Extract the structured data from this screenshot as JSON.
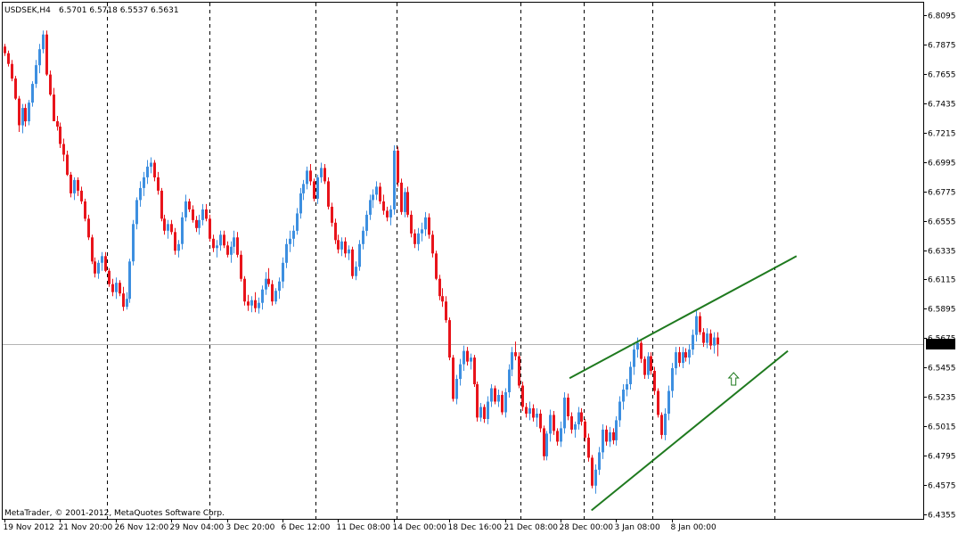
{
  "header": {
    "symbol": "USDSEK,H4",
    "ohlc": "6.5701 6.5718 6.5537 6.5631"
  },
  "footer": {
    "copyright": "MetaTrader, © 2001-2012, MetaQuotes Software Corp."
  },
  "colors": {
    "up": "#3d8fe0",
    "down": "#e8141b",
    "trendline": "#1f7a1f",
    "arrow": "#1f7a1f",
    "grid": "#000000",
    "priceline": "#b4b4b4",
    "axis": "#000000",
    "label_bg": "#000000",
    "label_fg": "#ffffff"
  },
  "chart_data": {
    "type": "candlestick",
    "timeframe": "H4",
    "current_price_label": "6.5631",
    "current_price": 6.5631,
    "ylim": [
      6.4355,
      6.8095
    ],
    "y_ticks": [
      {
        "value": 6.8095,
        "label": "6.8095"
      },
      {
        "value": 6.7875,
        "label": "6.7875"
      },
      {
        "value": 6.7655,
        "label": "6.7655"
      },
      {
        "value": 6.7435,
        "label": "6.7435"
      },
      {
        "value": 6.7215,
        "label": "6.7215"
      },
      {
        "value": 6.6995,
        "label": "6.6995"
      },
      {
        "value": 6.6775,
        "label": "6.6775"
      },
      {
        "value": 6.6555,
        "label": "6.6555"
      },
      {
        "value": 6.6335,
        "label": "6.6335"
      },
      {
        "value": 6.6115,
        "label": "6.6115"
      },
      {
        "value": 6.5895,
        "label": "6.5895"
      },
      {
        "value": 6.5675,
        "label": "6.5675"
      },
      {
        "value": 6.5455,
        "label": "6.5455"
      },
      {
        "value": 6.5235,
        "label": "6.5235"
      },
      {
        "value": 6.5015,
        "label": "6.5015"
      },
      {
        "value": 6.4795,
        "label": "6.4795"
      },
      {
        "value": 6.4575,
        "label": "6.4575"
      },
      {
        "value": 6.4355,
        "label": "6.4355"
      }
    ],
    "x_ticks": [
      {
        "bar": 0,
        "label": "19 Nov 2012"
      },
      {
        "bar": 16,
        "label": "21 Nov 20:00"
      },
      {
        "bar": 32,
        "label": "26 Nov 12:00"
      },
      {
        "bar": 48,
        "label": "29 Nov 04:00"
      },
      {
        "bar": 64,
        "label": "3 Dec 20:00"
      },
      {
        "bar": 80,
        "label": "6 Dec 12:00"
      },
      {
        "bar": 96,
        "label": "11 Dec 08:00"
      },
      {
        "bar": 112,
        "label": "14 Dec 00:00"
      },
      {
        "bar": 128,
        "label": "18 Dec 16:00"
      },
      {
        "bar": 144,
        "label": "21 Dec 08:00"
      },
      {
        "bar": 160,
        "label": "28 Dec 00:00"
      },
      {
        "bar": 176,
        "label": "3 Jan 08:00"
      },
      {
        "bar": 192,
        "label": "8 Jan 00:00"
      }
    ],
    "separators_bar": [
      29.6,
      59.1,
      89.5,
      112.9,
      148.4,
      166.7,
      186.5,
      221.6
    ],
    "bar_count": 210,
    "candles": [
      [
        6.786,
        6.788,
        6.779,
        6.781
      ],
      [
        6.781,
        6.783,
        6.771,
        6.773
      ],
      [
        6.773,
        6.776,
        6.76,
        6.762
      ],
      [
        6.762,
        6.764,
        6.746,
        6.747
      ],
      [
        6.747,
        6.749,
        6.722,
        6.727
      ],
      [
        6.727,
        6.743,
        6.721,
        6.74
      ],
      [
        6.74,
        6.743,
        6.726,
        6.73
      ],
      [
        6.73,
        6.746,
        6.727,
        6.744
      ],
      [
        6.744,
        6.76,
        6.741,
        6.758
      ],
      [
        6.758,
        6.776,
        6.755,
        6.772
      ],
      [
        6.772,
        6.788,
        6.766,
        6.784
      ],
      [
        6.784,
        6.798,
        6.781,
        6.795
      ],
      [
        6.795,
        6.798,
        6.764,
        6.765
      ],
      [
        6.765,
        6.768,
        6.749,
        6.75
      ],
      [
        6.75,
        6.755,
        6.73,
        6.73
      ],
      [
        6.73,
        6.734,
        6.723,
        6.726
      ],
      [
        6.726,
        6.729,
        6.71,
        6.713
      ],
      [
        6.713,
        6.717,
        6.7,
        6.705
      ],
      [
        6.705,
        6.708,
        6.689,
        6.69
      ],
      [
        6.69,
        6.692,
        6.673,
        6.676
      ],
      [
        6.676,
        6.688,
        6.671,
        6.686
      ],
      [
        6.686,
        6.688,
        6.674,
        6.678
      ],
      [
        6.678,
        6.681,
        6.668,
        6.67
      ],
      [
        6.67,
        6.672,
        6.655,
        6.657
      ],
      [
        6.657,
        6.66,
        6.641,
        6.643
      ],
      [
        6.643,
        6.645,
        6.623,
        6.625
      ],
      [
        6.625,
        6.628,
        6.613,
        6.616
      ],
      [
        6.616,
        6.626,
        6.612,
        6.624
      ],
      [
        6.624,
        6.632,
        6.618,
        6.629
      ],
      [
        6.629,
        6.632,
        6.617,
        6.618
      ],
      [
        6.618,
        6.62,
        6.606,
        6.608
      ],
      [
        6.608,
        6.612,
        6.599,
        6.602
      ],
      [
        6.602,
        6.613,
        6.597,
        6.609
      ],
      [
        6.609,
        6.611,
        6.599,
        6.601
      ],
      [
        6.601,
        6.606,
        6.588,
        6.591
      ],
      [
        6.591,
        6.602,
        6.589,
        6.597
      ],
      [
        6.597,
        6.627,
        6.594,
        6.625
      ],
      [
        6.625,
        6.656,
        6.622,
        6.653
      ],
      [
        6.653,
        6.673,
        6.649,
        6.671
      ],
      [
        6.671,
        6.685,
        6.666,
        6.68
      ],
      [
        6.68,
        6.692,
        6.674,
        6.688
      ],
      [
        6.688,
        6.701,
        6.683,
        6.696
      ],
      [
        6.696,
        6.703,
        6.691,
        6.699
      ],
      [
        6.699,
        6.701,
        6.685,
        6.688
      ],
      [
        6.688,
        6.692,
        6.675,
        6.678
      ],
      [
        6.678,
        6.68,
        6.655,
        6.657
      ],
      [
        6.657,
        6.66,
        6.645,
        6.648
      ],
      [
        6.648,
        6.656,
        6.642,
        6.653
      ],
      [
        6.653,
        6.656,
        6.645,
        6.647
      ],
      [
        6.647,
        6.65,
        6.63,
        6.633
      ],
      [
        6.633,
        6.641,
        6.628,
        6.638
      ],
      [
        6.638,
        6.662,
        6.634,
        6.658
      ],
      [
        6.658,
        6.675,
        6.655,
        6.67
      ],
      [
        6.67,
        6.672,
        6.662,
        6.664
      ],
      [
        6.664,
        6.667,
        6.654,
        6.656
      ],
      [
        6.656,
        6.659,
        6.647,
        6.65
      ],
      [
        6.65,
        6.66,
        6.645,
        6.656
      ],
      [
        6.656,
        6.668,
        6.652,
        6.664
      ],
      [
        6.664,
        6.668,
        6.655,
        6.657
      ],
      [
        6.657,
        6.66,
        6.64,
        6.642
      ],
      [
        6.642,
        6.645,
        6.632,
        6.635
      ],
      [
        6.635,
        6.641,
        6.628,
        6.637
      ],
      [
        6.637,
        6.648,
        6.633,
        6.645
      ],
      [
        6.645,
        6.648,
        6.635,
        6.637
      ],
      [
        6.637,
        6.64,
        6.628,
        6.63
      ],
      [
        6.63,
        6.64,
        6.624,
        6.636
      ],
      [
        6.636,
        6.648,
        6.631,
        6.643
      ],
      [
        6.643,
        6.647,
        6.628,
        6.63
      ],
      [
        6.63,
        6.633,
        6.61,
        6.612
      ],
      [
        6.612,
        6.614,
        6.592,
        6.595
      ],
      [
        6.595,
        6.6,
        6.588,
        6.592
      ],
      [
        6.592,
        6.599,
        6.587,
        6.596
      ],
      [
        6.596,
        6.602,
        6.587,
        6.59
      ],
      [
        6.59,
        6.598,
        6.586,
        6.594
      ],
      [
        6.594,
        6.607,
        6.589,
        6.604
      ],
      [
        6.604,
        6.617,
        6.6,
        6.612
      ],
      [
        6.612,
        6.62,
        6.606,
        6.608
      ],
      [
        6.608,
        6.611,
        6.592,
        6.595
      ],
      [
        6.595,
        6.605,
        6.593,
        6.603
      ],
      [
        6.603,
        6.613,
        6.597,
        6.61
      ],
      [
        6.61,
        6.628,
        6.605,
        6.624
      ],
      [
        6.624,
        6.642,
        6.62,
        6.638
      ],
      [
        6.638,
        6.648,
        6.632,
        6.642
      ],
      [
        6.642,
        6.652,
        6.636,
        6.648
      ],
      [
        6.648,
        6.665,
        6.645,
        6.661
      ],
      [
        6.661,
        6.68,
        6.657,
        6.676
      ],
      [
        6.676,
        6.686,
        6.671,
        6.683
      ],
      [
        6.683,
        6.696,
        6.679,
        6.693
      ],
      [
        6.693,
        6.698,
        6.682,
        6.685
      ],
      [
        6.685,
        6.687,
        6.67,
        6.672
      ],
      [
        6.672,
        6.69,
        6.668,
        6.688
      ],
      [
        6.688,
        6.699,
        6.684,
        6.695
      ],
      [
        6.695,
        6.698,
        6.683,
        6.685
      ],
      [
        6.685,
        6.688,
        6.664,
        6.666
      ],
      [
        6.666,
        6.669,
        6.651,
        6.654
      ],
      [
        6.654,
        6.657,
        6.638,
        6.641
      ],
      [
        6.641,
        6.645,
        6.631,
        6.634
      ],
      [
        6.634,
        6.643,
        6.629,
        6.64
      ],
      [
        6.64,
        6.643,
        6.628,
        6.631
      ],
      [
        6.631,
        6.637,
        6.626,
        6.634
      ],
      [
        6.634,
        6.636,
        6.612,
        6.614
      ],
      [
        6.614,
        6.625,
        6.611,
        6.621
      ],
      [
        6.621,
        6.641,
        6.618,
        6.638
      ],
      [
        6.638,
        6.651,
        6.634,
        6.648
      ],
      [
        6.648,
        6.663,
        6.644,
        6.66
      ],
      [
        6.66,
        6.675,
        6.656,
        6.671
      ],
      [
        6.671,
        6.679,
        6.665,
        6.675
      ],
      [
        6.675,
        6.685,
        6.671,
        6.681
      ],
      [
        6.681,
        6.684,
        6.668,
        6.67
      ],
      [
        6.67,
        6.675,
        6.66,
        6.663
      ],
      [
        6.663,
        6.666,
        6.655,
        6.658
      ],
      [
        6.658,
        6.667,
        6.652,
        6.664
      ],
      [
        6.664,
        6.712,
        6.66,
        6.708
      ],
      [
        6.708,
        6.711,
        6.681,
        6.684
      ],
      [
        6.684,
        6.687,
        6.66,
        6.662
      ],
      [
        6.662,
        6.68,
        6.658,
        6.677
      ],
      [
        6.677,
        6.681,
        6.658,
        6.66
      ],
      [
        6.66,
        6.663,
        6.643,
        6.646
      ],
      [
        6.646,
        6.649,
        6.635,
        6.638
      ],
      [
        6.638,
        6.65,
        6.633,
        6.646
      ],
      [
        6.646,
        6.654,
        6.64,
        6.649
      ],
      [
        6.649,
        6.662,
        6.644,
        6.658
      ],
      [
        6.658,
        6.661,
        6.642,
        6.645
      ],
      [
        6.645,
        6.648,
        6.628,
        6.631
      ],
      [
        6.631,
        6.633,
        6.611,
        6.612
      ],
      [
        6.612,
        6.615,
        6.596,
        6.599
      ],
      [
        6.599,
        6.605,
        6.591,
        6.595
      ],
      [
        6.595,
        6.599,
        6.579,
        6.581
      ],
      [
        6.581,
        6.583,
        6.551,
        6.553
      ],
      [
        6.553,
        6.555,
        6.52,
        6.522
      ],
      [
        6.522,
        6.54,
        6.518,
        6.537
      ],
      [
        6.537,
        6.552,
        6.532,
        6.548
      ],
      [
        6.548,
        6.562,
        6.543,
        6.558
      ],
      [
        6.558,
        6.561,
        6.547,
        6.55
      ],
      [
        6.55,
        6.556,
        6.544,
        6.553
      ],
      [
        6.553,
        6.555,
        6.531,
        6.533
      ],
      [
        6.533,
        6.535,
        6.505,
        6.508
      ],
      [
        6.508,
        6.519,
        6.505,
        6.516
      ],
      [
        6.516,
        6.518,
        6.504,
        6.507
      ],
      [
        6.507,
        6.524,
        6.503,
        6.52
      ],
      [
        6.52,
        6.533,
        6.516,
        6.53
      ],
      [
        6.53,
        6.532,
        6.518,
        6.52
      ],
      [
        6.52,
        6.529,
        6.516,
        6.525
      ],
      [
        6.525,
        6.528,
        6.51,
        6.512
      ],
      [
        6.512,
        6.53,
        6.508,
        6.527
      ],
      [
        6.527,
        6.548,
        6.523,
        6.544
      ],
      [
        6.544,
        6.561,
        6.539,
        6.557
      ],
      [
        6.557,
        6.565,
        6.551,
        6.554
      ],
      [
        6.554,
        6.557,
        6.53,
        6.532
      ],
      [
        6.532,
        6.535,
        6.513,
        6.516
      ],
      [
        6.516,
        6.519,
        6.508,
        6.511
      ],
      [
        6.511,
        6.52,
        6.506,
        6.515
      ],
      [
        6.515,
        6.518,
        6.505,
        6.508
      ],
      [
        6.508,
        6.515,
        6.501,
        6.511
      ],
      [
        6.511,
        6.514,
        6.497,
        6.5
      ],
      [
        6.5,
        6.502,
        6.476,
        6.479
      ],
      [
        6.479,
        6.498,
        6.476,
        6.496
      ],
      [
        6.496,
        6.514,
        6.49,
        6.51
      ],
      [
        6.51,
        6.513,
        6.495,
        6.498
      ],
      [
        6.498,
        6.5,
        6.487,
        6.49
      ],
      [
        6.49,
        6.505,
        6.486,
        6.5
      ],
      [
        6.5,
        6.527,
        6.496,
        6.523
      ],
      [
        6.523,
        6.526,
        6.506,
        6.509
      ],
      [
        6.509,
        6.512,
        6.496,
        6.499
      ],
      [
        6.499,
        6.505,
        6.493,
        6.503
      ],
      [
        6.503,
        6.516,
        6.499,
        6.512
      ],
      [
        6.512,
        6.515,
        6.502,
        6.505
      ],
      [
        6.505,
        6.507,
        6.49,
        6.493
      ],
      [
        6.493,
        6.496,
        6.475,
        6.478
      ],
      [
        6.478,
        6.48,
        6.455,
        6.457
      ],
      [
        6.457,
        6.473,
        6.451,
        6.469
      ],
      [
        6.469,
        6.486,
        6.465,
        6.482
      ],
      [
        6.482,
        6.503,
        6.477,
        6.499
      ],
      [
        6.499,
        6.502,
        6.487,
        6.49
      ],
      [
        6.49,
        6.501,
        6.486,
        6.497
      ],
      [
        6.497,
        6.5,
        6.488,
        6.491
      ],
      [
        6.491,
        6.509,
        6.487,
        6.506
      ],
      [
        6.506,
        6.524,
        6.501,
        6.52
      ],
      [
        6.52,
        6.533,
        6.514,
        6.529
      ],
      [
        6.529,
        6.537,
        6.524,
        6.533
      ],
      [
        6.533,
        6.55,
        6.529,
        6.546
      ],
      [
        6.546,
        6.563,
        6.54,
        6.559
      ],
      [
        6.559,
        6.568,
        6.553,
        6.564
      ],
      [
        6.564,
        6.567,
        6.549,
        6.552
      ],
      [
        6.552,
        6.554,
        6.537,
        6.54
      ],
      [
        6.54,
        6.557,
        6.537,
        6.554
      ],
      [
        6.554,
        6.557,
        6.54,
        6.543
      ],
      [
        6.543,
        6.546,
        6.525,
        6.528
      ],
      [
        6.528,
        6.53,
        6.508,
        6.51
      ],
      [
        6.51,
        6.512,
        6.492,
        6.495
      ],
      [
        6.495,
        6.515,
        6.491,
        6.511
      ],
      [
        6.511,
        6.532,
        6.506,
        6.528
      ],
      [
        6.528,
        6.549,
        6.523,
        6.545
      ],
      [
        6.545,
        6.561,
        6.54,
        6.557
      ],
      [
        6.557,
        6.561,
        6.546,
        6.549
      ],
      [
        6.549,
        6.561,
        6.545,
        6.557
      ],
      [
        6.557,
        6.56,
        6.55,
        6.553
      ],
      [
        6.553,
        6.563,
        6.548,
        6.559
      ],
      [
        6.559,
        6.574,
        6.555,
        6.57
      ],
      [
        6.57,
        6.588,
        6.565,
        6.584
      ],
      [
        6.584,
        6.587,
        6.57,
        6.572
      ],
      [
        6.572,
        6.575,
        6.561,
        6.564
      ],
      [
        6.564,
        6.575,
        6.56,
        6.571
      ],
      [
        6.571,
        6.574,
        6.559,
        6.562
      ],
      [
        6.562,
        6.572,
        6.556,
        6.568
      ],
      [
        6.568,
        6.572,
        6.554,
        6.563
      ]
    ],
    "trendlines": [
      {
        "from": {
          "bar": 162.6,
          "price": 6.5375
        },
        "to": {
          "bar": 227.9,
          "price": 6.629
        }
      },
      {
        "from": {
          "bar": 168.9,
          "price": 6.4385
        },
        "to": {
          "bar": 225.4,
          "price": 6.558
        }
      }
    ],
    "arrow": {
      "bar": 209.8,
      "price": 6.537,
      "direction": "up"
    }
  }
}
